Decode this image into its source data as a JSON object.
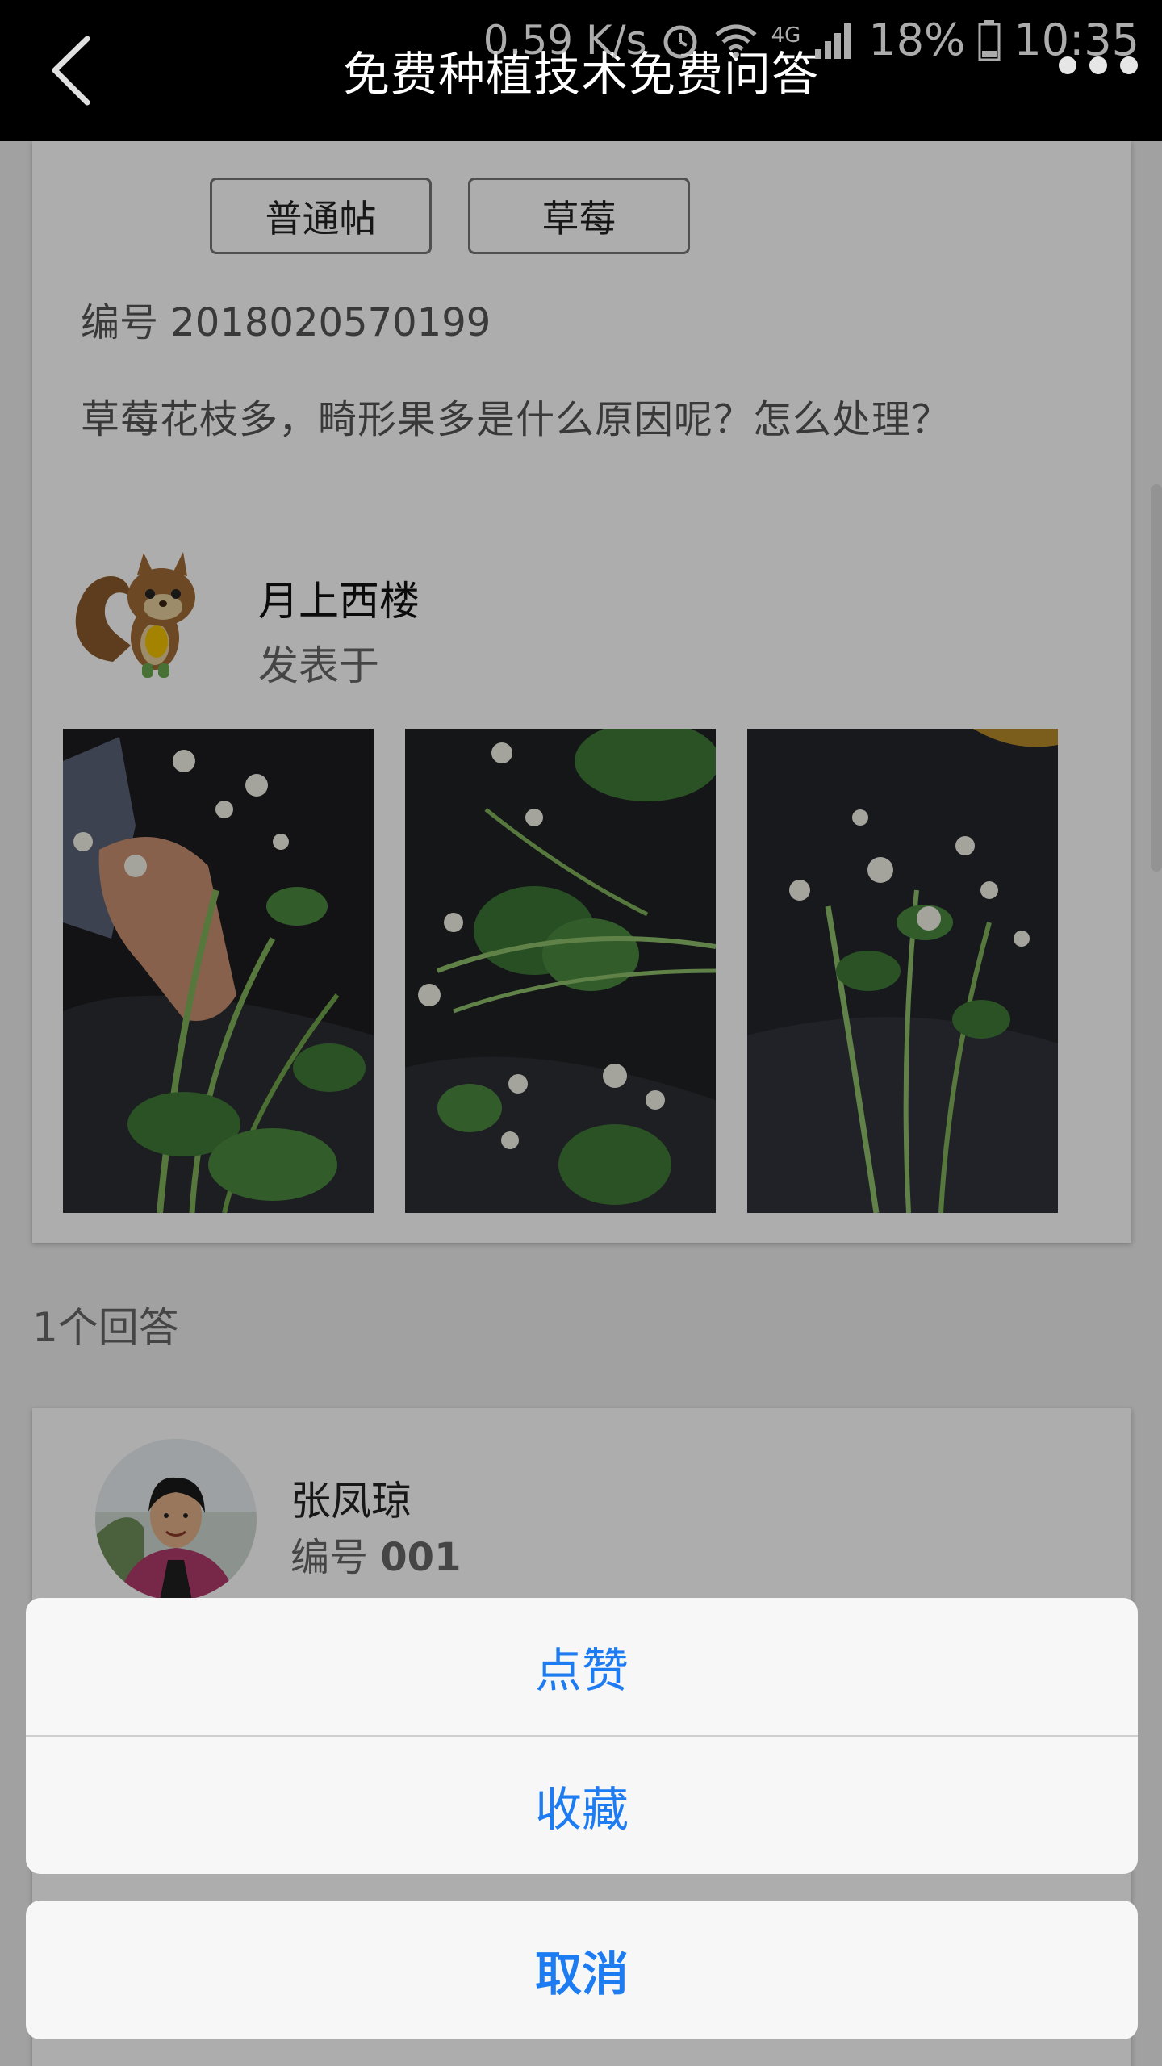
{
  "status_bar": {
    "speed": "0.59 K/s",
    "network": "4G",
    "battery": "18%",
    "time": "10:35"
  },
  "header": {
    "title": "免费种植技术免费问答"
  },
  "post": {
    "tags": [
      "普通帖",
      "草莓"
    ],
    "id_text": "编号 2018020570199",
    "question": "草莓花枝多，畸形果多是什么原因呢？怎么处理？",
    "author": {
      "name": "月上西楼",
      "meta": "发表于"
    }
  },
  "answers": {
    "count_text": "1个回答",
    "first": {
      "name": "张凤琼",
      "id_label": "编号",
      "id_value": "001"
    }
  },
  "action_sheet": {
    "like": "点赞",
    "favorite": "收藏",
    "cancel": "取消"
  },
  "colors": {
    "accent": "#1d7cf2",
    "header_bg": "#000000",
    "page_bg": "#ededed"
  }
}
